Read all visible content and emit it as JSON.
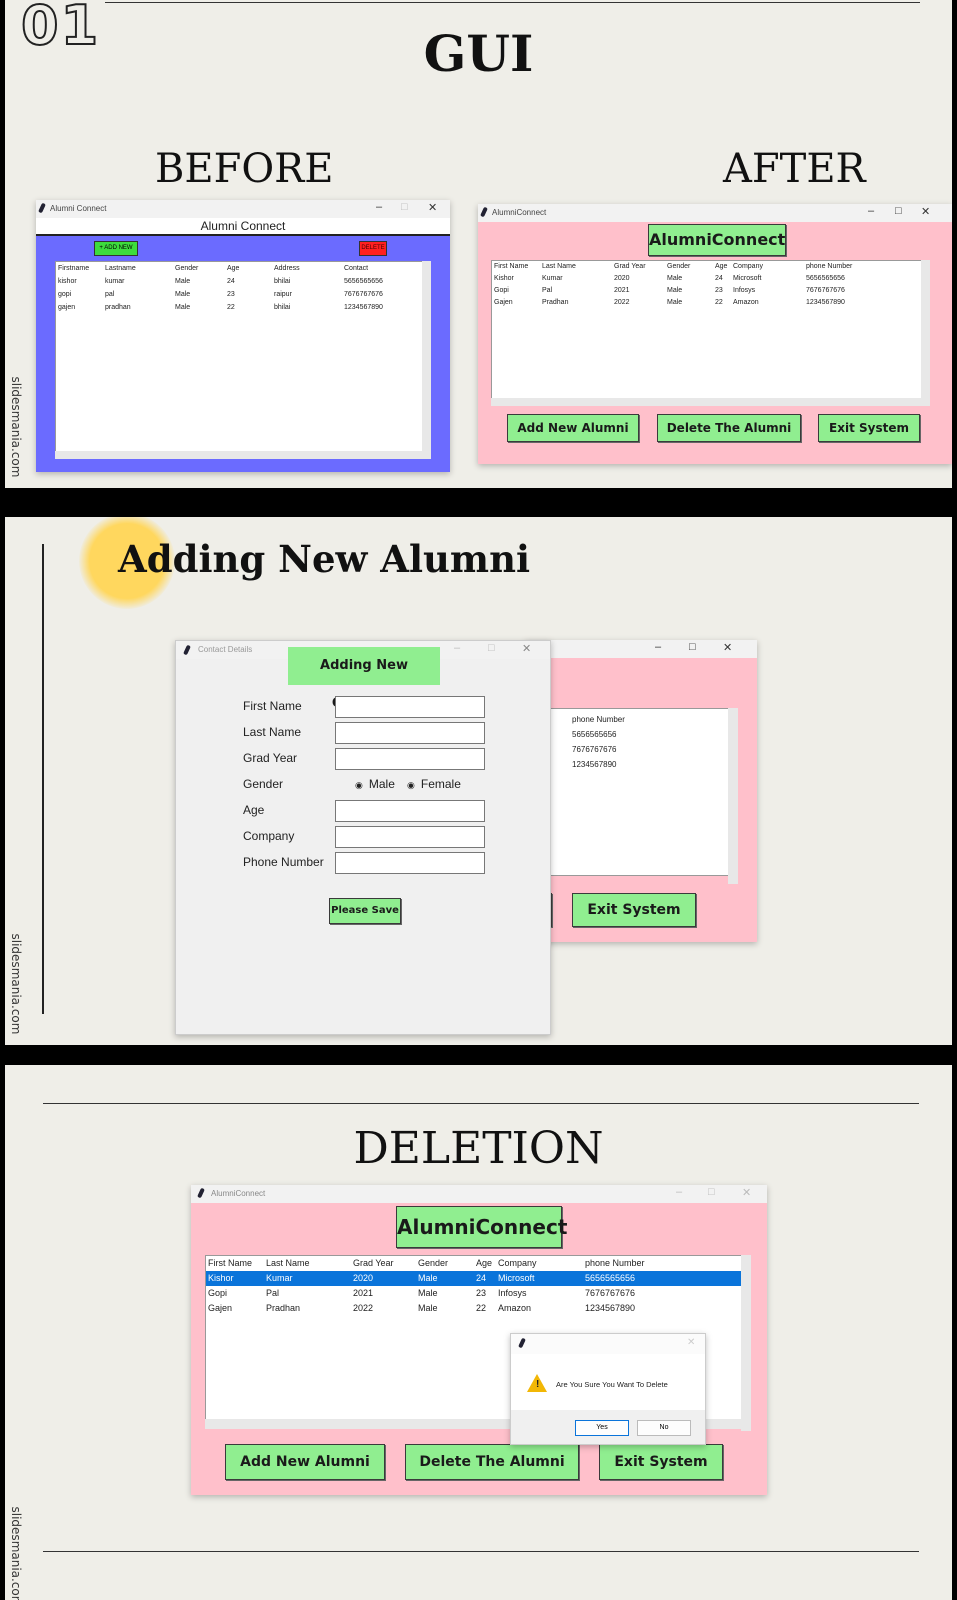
{
  "slide_number": "01",
  "section1": {
    "title": "GUI",
    "before_label": "BEFORE",
    "after_label": "AFTER",
    "old_window": {
      "title": "Alumni Connect",
      "heading": "Alumni Connect",
      "add_button": "+ ADD NEW",
      "delete_button": "DELETE",
      "columns": [
        "Firstname",
        "Lastname",
        "Gender",
        "Age",
        "Address",
        "Contact"
      ],
      "rows": [
        [
          "kishor",
          "kumar",
          "Male",
          "24",
          "bhilai",
          "5656565656"
        ],
        [
          "gopi",
          "pal",
          "Male",
          "23",
          "raipur",
          "7676767676"
        ],
        [
          "gajen",
          "pradhan",
          "Male",
          "22",
          "bhilai",
          "1234567890"
        ]
      ]
    },
    "new_window": {
      "title": "AlumniConnect",
      "heading": "AlumniConnect",
      "columns": [
        "First Name",
        "Last Name",
        "Grad Year",
        "Gender",
        "Age",
        "Company",
        "phone Number"
      ],
      "rows": [
        [
          "Kishor",
          "Kumar",
          "2020",
          "Male",
          "24",
          "Microsoft",
          "5656565656"
        ],
        [
          "Gopi",
          "Pal",
          "2021",
          "Male",
          "23",
          "Infosys",
          "7676767676"
        ],
        [
          "Gajen",
          "Pradhan",
          "2022",
          "Male",
          "22",
          "Amazon",
          "1234567890"
        ]
      ],
      "buttons": [
        "Add New Alumni",
        "Delete The Alumni",
        "Exit System"
      ]
    }
  },
  "section2": {
    "title": "Adding New Alumni",
    "dialog": {
      "title": "Contact Details",
      "heading": "Adding New Contacts",
      "labels": [
        "First Name",
        "Last Name",
        "Grad Year",
        "Gender",
        "Age",
        "Company",
        "Phone Number"
      ],
      "gender_options": [
        "Male",
        "Female"
      ],
      "save_button": "Please Save"
    },
    "background_window": {
      "column": "phone Number",
      "values": [
        "5656565656",
        "7676767676",
        "1234567890"
      ],
      "exit_button": "Exit System",
      "partial_button": "i"
    }
  },
  "section3": {
    "title": "DELETION",
    "window": {
      "title": "AlumniConnect",
      "heading": "AlumniConnect",
      "columns": [
        "First Name",
        "Last Name",
        "Grad Year",
        "Gender",
        "Age",
        "Company",
        "phone Number"
      ],
      "rows": [
        [
          "Kishor",
          "Kumar",
          "2020",
          "Male",
          "24",
          "Microsoft",
          "5656565656"
        ],
        [
          "Gopi",
          "Pal",
          "2021",
          "Male",
          "23",
          "Infosys",
          "7676767676"
        ],
        [
          "Gajen",
          "Pradhan",
          "2022",
          "Male",
          "22",
          "Amazon",
          "1234567890"
        ]
      ],
      "selected_row": 0,
      "buttons": [
        "Add New Alumni",
        "Delete The Alumni",
        "Exit System"
      ]
    },
    "confirm_dialog": {
      "message": "Are You Sure You Want To Delete",
      "yes": "Yes",
      "no": "No"
    }
  },
  "watermark": "slidesmania.com",
  "colors": {
    "slide_bg": "#efeee8",
    "old_window_bg": "#6b6bff",
    "new_window_bg": "#ffc0cb",
    "button_green": "#90ee90",
    "delete_red": "#ff2020",
    "selection_blue": "#0a74da",
    "highlight_yellow": "#ffd75e"
  }
}
